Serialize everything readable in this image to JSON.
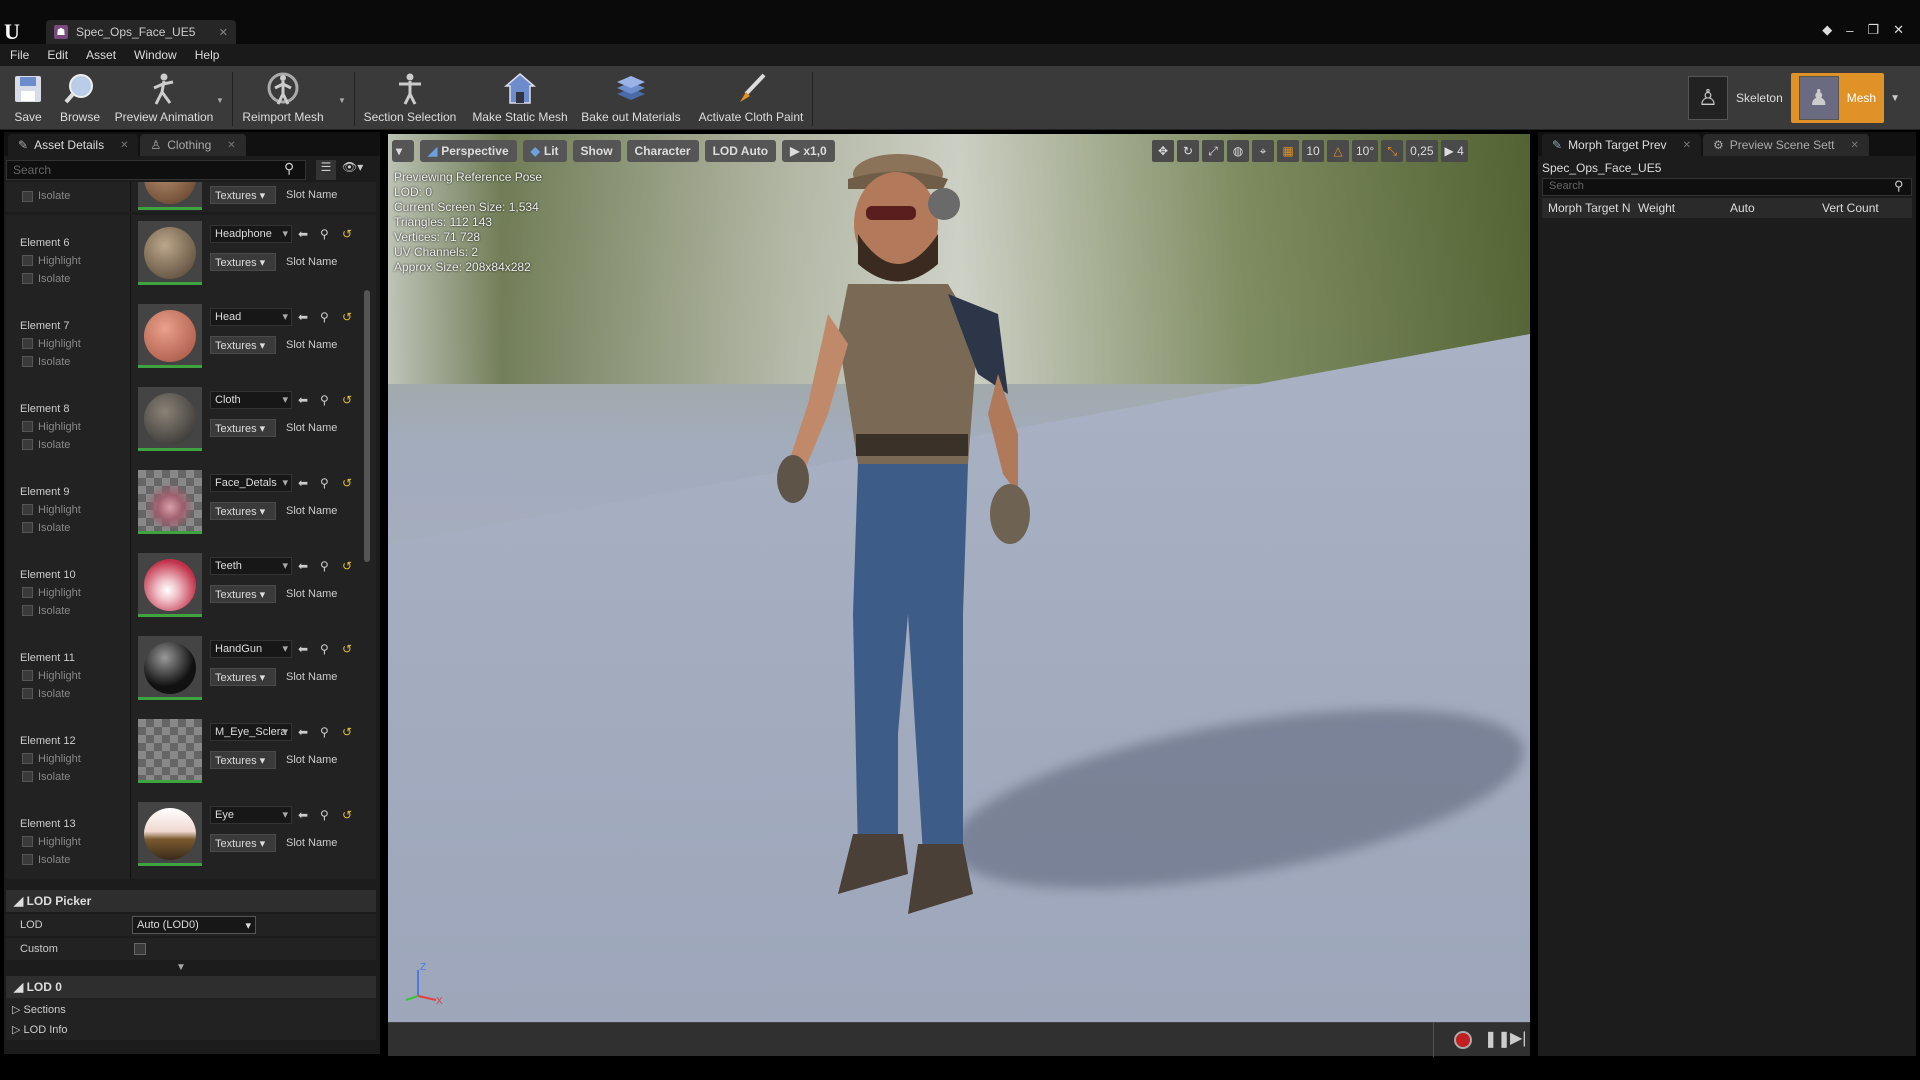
{
  "title_bar": {
    "tab_label": "Spec_Ops_Face_UE5",
    "logo": "U"
  },
  "window_controls": {
    "minimize": "–",
    "restore": "❐",
    "close": "✕"
  },
  "menu": [
    "File",
    "Edit",
    "Asset",
    "Window",
    "Help"
  ],
  "toolbar": {
    "save": "Save",
    "browse": "Browse",
    "preview_animation": "Preview Animation",
    "reimport_mesh": "Reimport Mesh",
    "section_selection": "Section Selection",
    "make_static_mesh": "Make Static Mesh",
    "bake_out_materials": "Bake out Materials",
    "activate_cloth_paint": "Activate Cloth Paint"
  },
  "modes": {
    "skeleton": "Skeleton",
    "mesh": "Mesh"
  },
  "left_tabs": [
    "Asset Details",
    "Clothing"
  ],
  "search_placeholder": "Search",
  "elements_common": {
    "highlight": "Highlight",
    "isolate": "Isolate",
    "textures": "Textures",
    "slot_name": "Slot Name"
  },
  "elements": [
    {
      "name": "Element 6",
      "material": "Headphone"
    },
    {
      "name": "Element 7",
      "material": "Head"
    },
    {
      "name": "Element 8",
      "material": "Cloth"
    },
    {
      "name": "Element 9",
      "material": "Face_Detals"
    },
    {
      "name": "Element 10",
      "material": "Teeth"
    },
    {
      "name": "Element 11",
      "material": "HandGun"
    },
    {
      "name": "Element 12",
      "material": "M_Eye_Sclera"
    },
    {
      "name": "Element 13",
      "material": "Eye"
    }
  ],
  "lod_picker": {
    "header": "LOD Picker",
    "lod_label": "LOD",
    "lod_value": "Auto (LOD0)",
    "custom_label": "Custom"
  },
  "lod0": {
    "header": "LOD 0",
    "sections": "Sections",
    "lod_info": "LOD Info"
  },
  "viewport": {
    "perspective": "Perspective",
    "lit": "Lit",
    "show": "Show",
    "character": "Character",
    "lod_auto": "LOD Auto",
    "speed": "x1,0",
    "grid": "10",
    "angle": "10°",
    "scale": "0,25",
    "cam_speed": "4",
    "info": [
      "Previewing Reference Pose",
      "LOD: 0",
      "Current Screen Size: 1,534",
      "Triangles: 112 143",
      "Vertices: 71 728",
      "UV Channels: 2",
      "Approx Size: 208x84x282"
    ]
  },
  "right_tabs": [
    "Morph Target Prev",
    "Preview Scene Sett"
  ],
  "morph": {
    "asset_name": "Spec_Ops_Face_UE5",
    "columns": [
      "Morph Target N",
      "Weight",
      "Auto",
      "Vert Count"
    ]
  }
}
